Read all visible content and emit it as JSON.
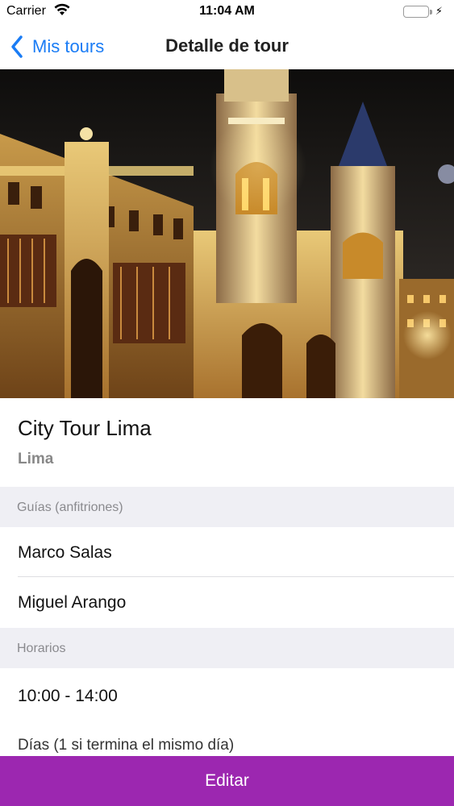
{
  "status_bar": {
    "carrier": "Carrier",
    "time": "11:04 AM",
    "battery_color": "#4cd964"
  },
  "nav": {
    "back_label": "Mis tours",
    "title": "Detalle de tour",
    "tint": "#1a7cf5"
  },
  "hero": {
    "image_subject": "Lima cathedral at night"
  },
  "tour": {
    "name": "City Tour Lima",
    "city": "Lima"
  },
  "guides_section": {
    "header": "Guías (anfitriones)",
    "items": [
      "Marco Salas",
      "Miguel Arango"
    ]
  },
  "schedule_section": {
    "header": "Horarios",
    "times": "10:00 - 14:00",
    "days_label": "Días (1 si termina el mismo día)"
  },
  "actions": {
    "edit_label": "Editar",
    "edit_color": "#9c27b0"
  }
}
